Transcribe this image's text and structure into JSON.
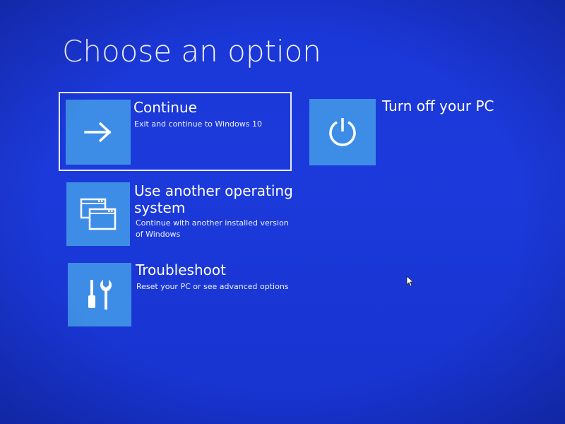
{
  "screen": {
    "title": "Choose an option",
    "background_color": "#1836d8",
    "tile_color": "#3d8de6"
  },
  "options": {
    "continue": {
      "label": "Continue",
      "description": "Exit and continue to Windows 10",
      "icon": "arrow-right-icon",
      "selected": true
    },
    "turn_off": {
      "label": "Turn off your PC",
      "icon": "power-icon"
    },
    "other_os": {
      "label": "Use another operating system",
      "description": "Continue with another installed version of Windows",
      "icon": "windows-stack-icon"
    },
    "troubleshoot": {
      "label": "Troubleshoot",
      "description": "Reset your PC or see advanced options",
      "icon": "tools-icon"
    }
  }
}
